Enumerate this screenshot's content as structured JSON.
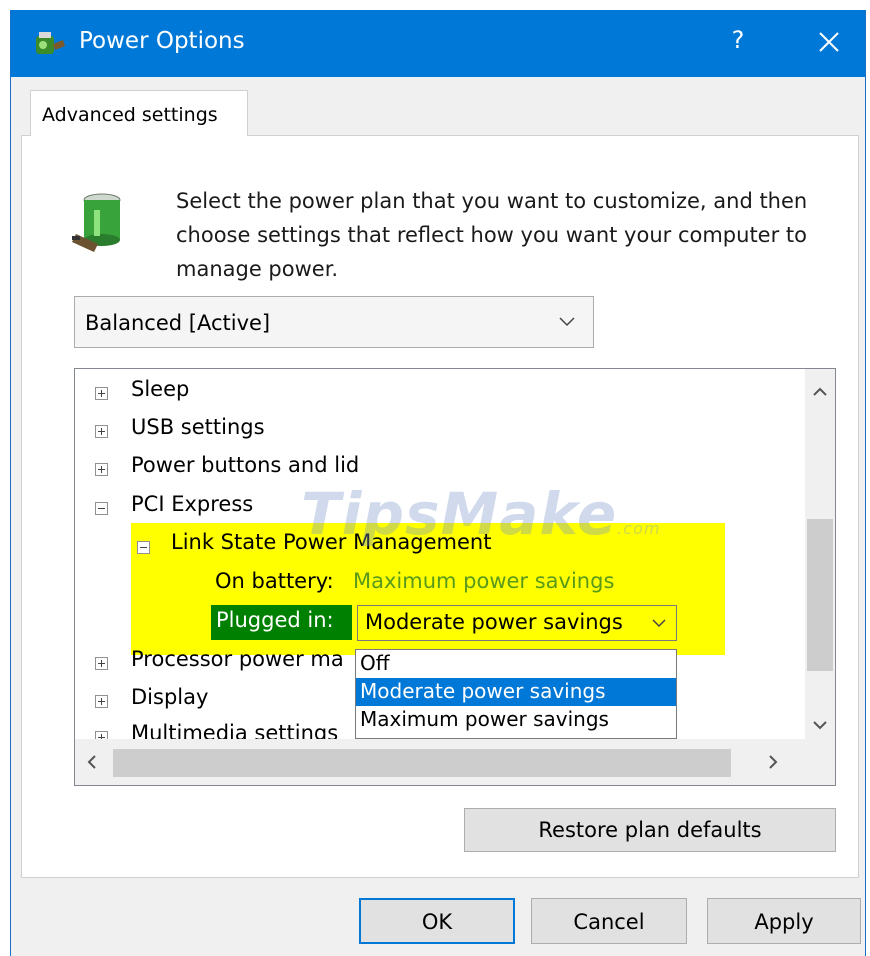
{
  "window": {
    "title": "Power Options",
    "help_label": "?",
    "app_icon": "power-options-icon",
    "close_icon": "close-icon"
  },
  "tab": {
    "label": "Advanced settings"
  },
  "intro": {
    "text": "Select the power plan that you want to customize, and then choose settings that reflect how you want your computer to manage power."
  },
  "plan_select": {
    "value": "Balanced [Active]"
  },
  "tree": {
    "items": [
      {
        "label": "Sleep",
        "state": "collapsed"
      },
      {
        "label": "USB settings",
        "state": "collapsed"
      },
      {
        "label": "Power buttons and lid",
        "state": "collapsed"
      },
      {
        "label": "PCI Express",
        "state": "expanded"
      },
      {
        "label": "Link State Power Management",
        "state": "expanded"
      },
      {
        "label": "Processor power ma",
        "state": "collapsed"
      },
      {
        "label": "Display",
        "state": "collapsed"
      },
      {
        "label": "Multimedia settings",
        "state": "collapsed"
      }
    ],
    "on_battery_label": "On battery:",
    "on_battery_value": "Maximum power savings",
    "plugged_in_label": "Plugged in:",
    "plugged_in_value": "Moderate power savings",
    "dropdown_options": [
      "Off",
      "Moderate power savings",
      "Maximum power savings"
    ],
    "selected_option": "Moderate power savings",
    "highlight_color": "#ffff00",
    "plugged_label_color": "#008000"
  },
  "watermark": {
    "main": "TipsMake",
    "suffix": ".com"
  },
  "buttons": {
    "restore": "Restore plan defaults",
    "ok": "OK",
    "cancel": "Cancel",
    "apply": "Apply"
  },
  "colors": {
    "titlebar": "#0078d7",
    "selection": "#0078d7"
  }
}
